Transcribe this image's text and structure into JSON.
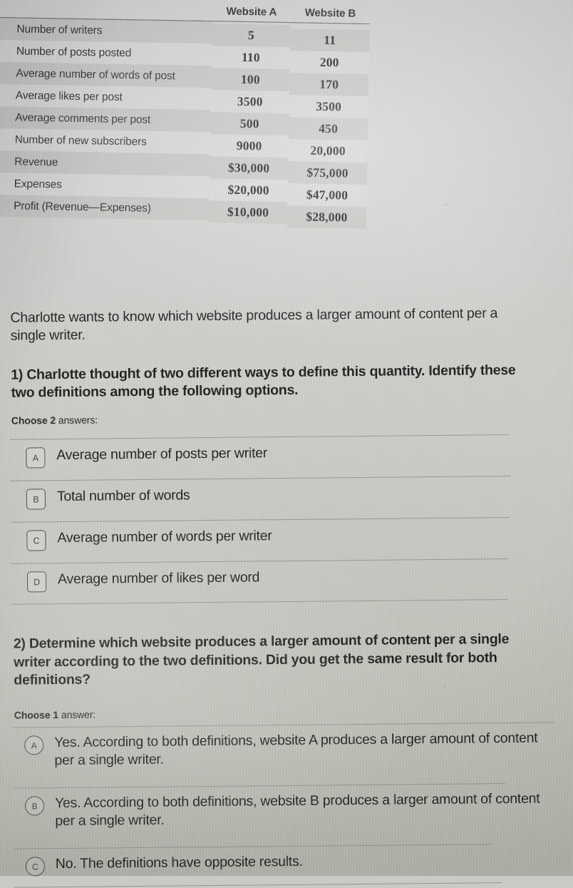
{
  "table": {
    "row_header_label": "",
    "columns": [
      "Website A",
      "Website B"
    ],
    "rows": [
      {
        "label": "Number of writers",
        "website_a": "5",
        "website_b": "11"
      },
      {
        "label": "Number of posts posted",
        "website_a": "110",
        "website_b": "200"
      },
      {
        "label": "Average number of words of post",
        "website_a": "100",
        "website_b": "170"
      },
      {
        "label": "Average likes per post",
        "website_a": "3500",
        "website_b": "3500"
      },
      {
        "label": "Average comments per post",
        "website_a": "500",
        "website_b": "450"
      },
      {
        "label": "Number of new subscribers",
        "website_a": "9000",
        "website_b": "20,000"
      },
      {
        "label": "Revenue",
        "website_a": "$30,000",
        "website_b": "$75,000"
      },
      {
        "label": "Expenses",
        "website_a": "$20,000",
        "website_b": "$47,000"
      },
      {
        "label": "Profit (Revenue—Expenses)",
        "website_a": "$10,000",
        "website_b": "$28,000"
      }
    ]
  },
  "intro": {
    "text": "Charlotte wants to know which website produces a larger amount of content per a single writer."
  },
  "question1": {
    "prompt": "1) Charlotte thought of two different ways to define this quantity. Identify these two definitions among the following options.",
    "choose_bold": "Choose 2",
    "choose_light": " answers:",
    "options": [
      {
        "letter": "A",
        "label": "Average number of posts per writer"
      },
      {
        "letter": "B",
        "label": "Total number of words"
      },
      {
        "letter": "C",
        "label": "Average number of words per writer"
      },
      {
        "letter": "D",
        "label": "Average number of likes per word"
      }
    ]
  },
  "question2": {
    "prompt": "2) Determine which website produces a larger amount of content per a single writer according to the two definitions. Did you get the same result for both definitions?",
    "choose_bold": "Choose 1",
    "choose_light": " answer:",
    "options": [
      {
        "letter": "A",
        "label": "Yes. According to both definitions, website A produces a larger amount of content per a single writer."
      },
      {
        "letter": "B",
        "label": "Yes. According to both definitions, website B produces a larger amount of content per a single writer."
      },
      {
        "letter": "C",
        "label": "No. The definitions have opposite results."
      }
    ]
  },
  "colors": {
    "page_background_top": "#d2d2d1",
    "page_background_bottom": "#b0b3aa",
    "text": "#1e1e1e",
    "divider": "#8a8c88",
    "table_band": "#80827e",
    "table_rule": "#6d6e6d"
  }
}
